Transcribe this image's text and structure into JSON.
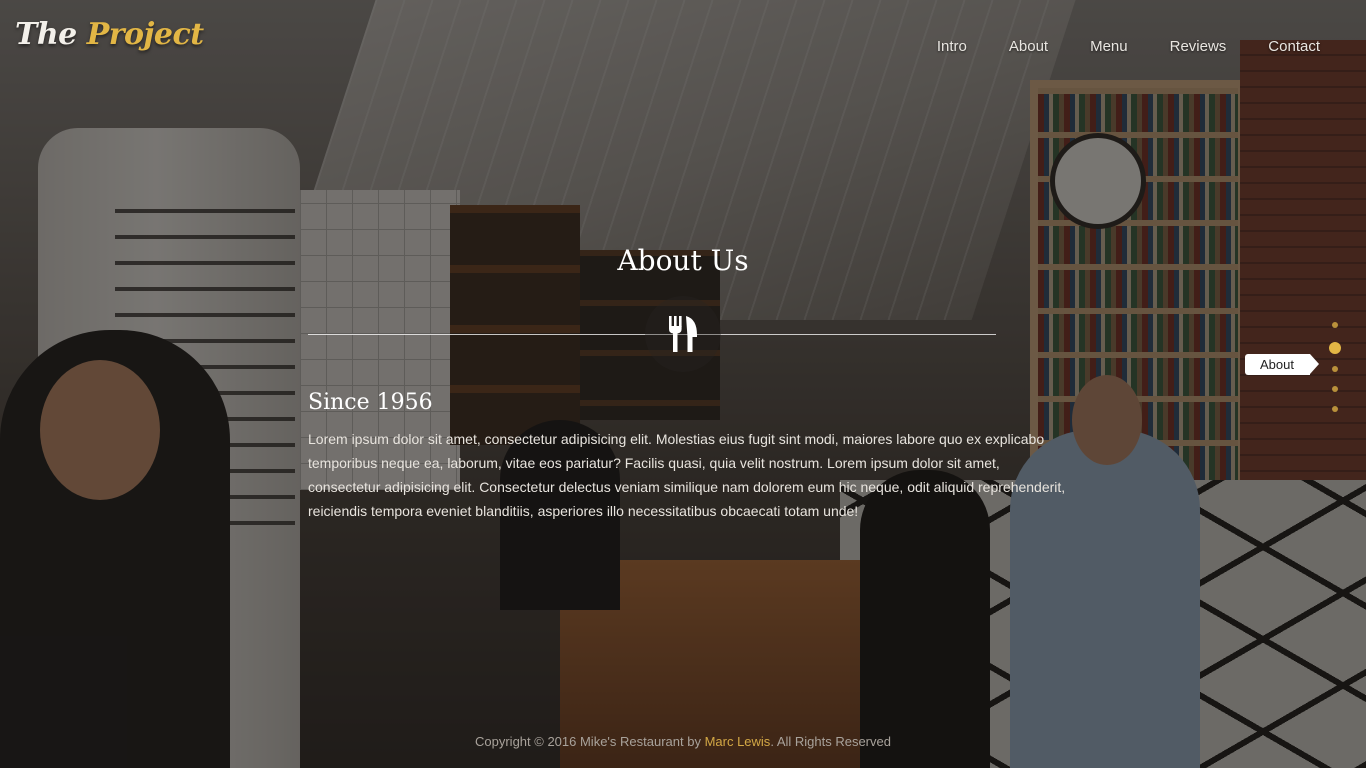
{
  "logo": {
    "part1": "The",
    "part2": "Project"
  },
  "nav": {
    "items": [
      {
        "label": "Intro"
      },
      {
        "label": "About"
      },
      {
        "label": "Menu"
      },
      {
        "label": "Reviews"
      },
      {
        "label": "Contact"
      }
    ]
  },
  "section": {
    "title": "About Us",
    "icon": "fork-knife-icon",
    "subtitle": "Since 1956",
    "paragraph": "Lorem ipsum dolor sit amet, consectetur adipisicing elit. Molestias eius fugit sint modi, maiores labore quo ex explicabo temporibus neque ea, laborum, vitae eos pariatur? Facilis quasi, quia velit nostrum. Lorem ipsum dolor sit amet, consectetur adipisicing elit. Consectetur delectus veniam similique nam dolorem eum hic neque, odit aliquid reprehenderit, reiciendis tempora eveniet blanditiis, asperiores illo necessitatibus obcaecati totam unde!"
  },
  "side_nav": {
    "tooltip": "About",
    "active_index": 2,
    "dot_count": 6
  },
  "footer": {
    "text_before": "Copyright © 2016 Mike's Restaurant by ",
    "author": "Marc Lewis",
    "text_after": ". All Rights Reserved"
  },
  "colors": {
    "accent": "#e2b645",
    "text": "#ffffff"
  }
}
